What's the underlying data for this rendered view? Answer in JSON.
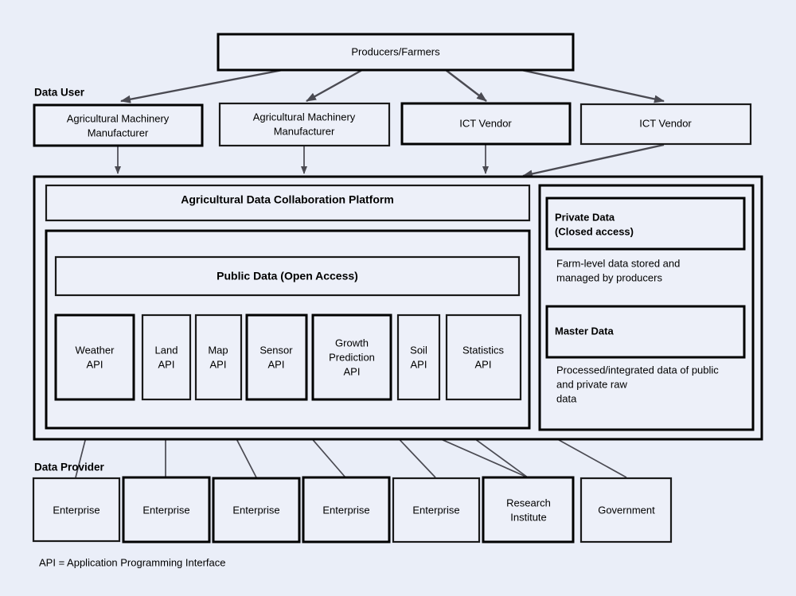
{
  "diagram": {
    "title_top_box": "Producers/Farmers",
    "section_labels": {
      "data_user": "Data User",
      "data_provider": "Data Provider"
    },
    "data_users": [
      "Agricultural Machinery\nManufacturer",
      "Agricultural Machinery\nManufacturer",
      "ICT Vendor",
      "ICT Vendor"
    ],
    "data_users_flat": [
      {
        "line1": "Agricultural Machinery",
        "line2": "Manufacturer"
      },
      {
        "line1": "Agricultural Machinery",
        "line2": "Manufacturer"
      },
      {
        "line1": "ICT Vendor",
        "line2": ""
      },
      {
        "line1": "ICT Vendor",
        "line2": ""
      }
    ],
    "platform": {
      "header": "Agricultural Data Collaboration Platform",
      "public_data_header": "Public Data (Open Access)",
      "apis": [
        {
          "line1": "Weather",
          "line2": "API",
          "line3": ""
        },
        {
          "line1": "Land",
          "line2": "API",
          "line3": ""
        },
        {
          "line1": "Map",
          "line2": "API",
          "line3": ""
        },
        {
          "line1": "Sensor",
          "line2": "API",
          "line3": ""
        },
        {
          "line1": "Growth",
          "line2": "Prediction",
          "line3": "API"
        },
        {
          "line1": "Soil",
          "line2": "API",
          "line3": ""
        },
        {
          "line1": "Statistics",
          "line2": "API",
          "line3": ""
        }
      ]
    },
    "right_panel": {
      "private_data": {
        "line1": "Private Data",
        "line2": "(Closed access)"
      },
      "private_note": {
        "line1": "Farm-level data stored and",
        "line2": "managed by producers"
      },
      "master_data": {
        "line1": "Master Data"
      },
      "master_note": {
        "line1": "Processed/integrated data of public",
        "line2": "and private raw",
        "line3": "data"
      }
    },
    "data_providers": [
      {
        "line1": "Enterprise",
        "line2": ""
      },
      {
        "line1": "Enterprise",
        "line2": ""
      },
      {
        "line1": "Enterprise",
        "line2": ""
      },
      {
        "line1": "Enterprise",
        "line2": ""
      },
      {
        "line1": "Enterprise",
        "line2": ""
      },
      {
        "line1": "Research",
        "line2": "Institute"
      },
      {
        "line1": "Government",
        "line2": ""
      }
    ],
    "footnote": "API = Application Programming Interface",
    "colors": {
      "background": "#eaeef8",
      "box_fill": "#edf0f9",
      "box_border": "#000000",
      "arrow": "#4a4a52",
      "text": "#000000"
    }
  }
}
